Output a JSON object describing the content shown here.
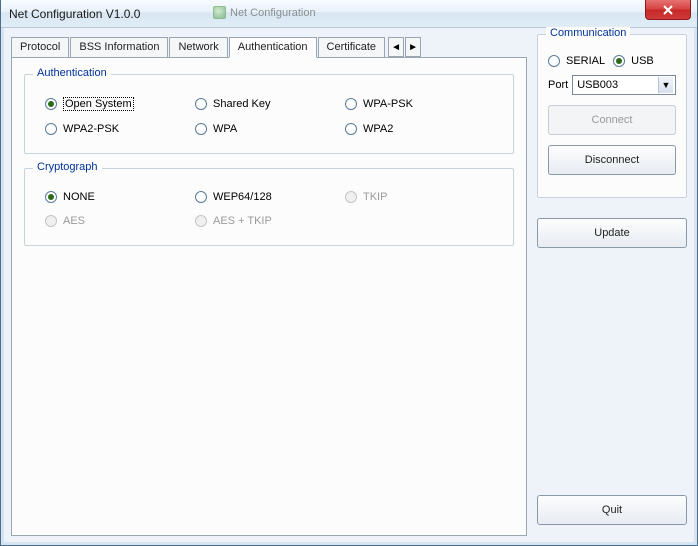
{
  "window": {
    "title": "Net Configuration V1.0.0"
  },
  "bg_tab_ghost": "Net Configuration ",
  "tabs": {
    "items": [
      {
        "label": "Protocol"
      },
      {
        "label": "BSS Information"
      },
      {
        "label": "Network"
      },
      {
        "label": "Authentication"
      },
      {
        "label": "Certificate"
      }
    ],
    "active_index": 3
  },
  "auth_group": {
    "legend": "Authentication",
    "options": [
      {
        "label": "Open System",
        "checked": true,
        "focused": true
      },
      {
        "label": "Shared Key",
        "checked": false
      },
      {
        "label": "WPA-PSK",
        "checked": false
      },
      {
        "label": "WPA2-PSK",
        "checked": false
      },
      {
        "label": "WPA",
        "checked": false
      },
      {
        "label": "WPA2",
        "checked": false
      }
    ]
  },
  "crypt_group": {
    "legend": "Cryptograph",
    "options": [
      {
        "label": "NONE",
        "checked": true,
        "disabled": false
      },
      {
        "label": "WEP64/128",
        "checked": false,
        "disabled": false
      },
      {
        "label": "TKIP",
        "checked": false,
        "disabled": true
      },
      {
        "label": "AES",
        "checked": false,
        "disabled": true
      },
      {
        "label": "AES + TKIP",
        "checked": false,
        "disabled": true
      }
    ]
  },
  "comm": {
    "legend": "Communication",
    "serial_label": "SERIAL",
    "usb_label": "USB",
    "selected": "USB",
    "port_label": "Port",
    "port_value": "USB003",
    "connect_label": "Connect",
    "disconnect_label": "Disconnect"
  },
  "buttons": {
    "update": "Update",
    "quit": "Quit"
  }
}
